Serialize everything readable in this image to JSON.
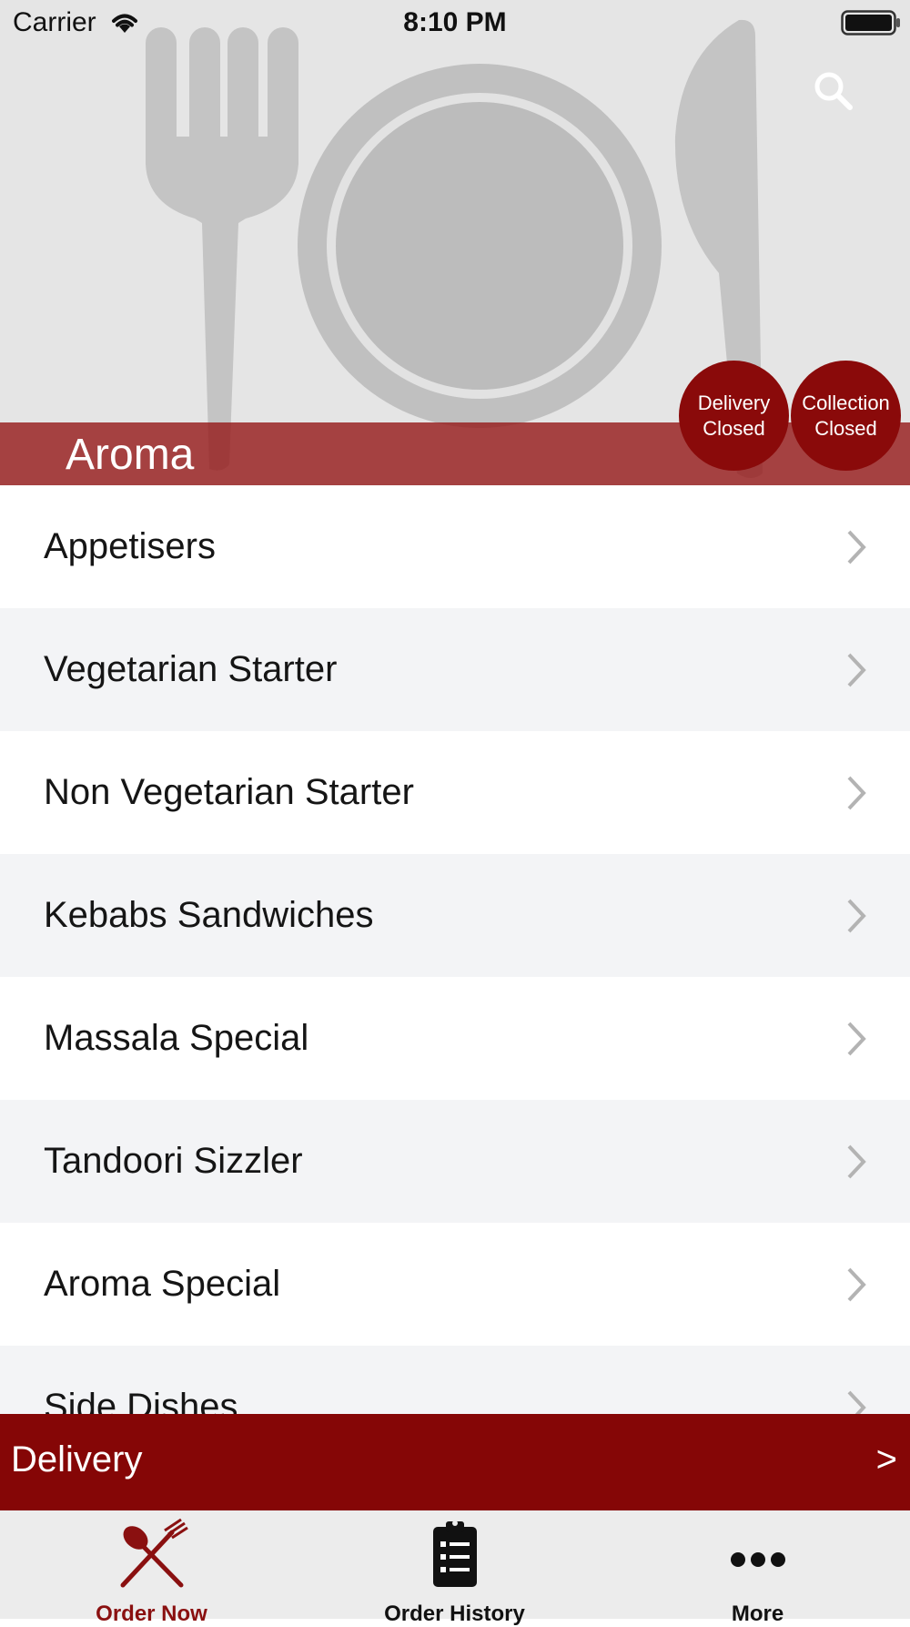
{
  "status_bar": {
    "carrier": "Carrier",
    "time": "8:10 PM"
  },
  "header": {
    "restaurant_name": "Aroma",
    "delivery_status": {
      "line1": "Delivery",
      "line2": "Closed"
    },
    "collection_status": {
      "line1": "Collection",
      "line2": "Closed"
    }
  },
  "menu": {
    "items": [
      {
        "label": "Appetisers"
      },
      {
        "label": "Vegetarian Starter"
      },
      {
        "label": "Non Vegetarian Starter"
      },
      {
        "label": "Kebabs Sandwiches"
      },
      {
        "label": "Massala Special"
      },
      {
        "label": "Tandoori Sizzler"
      },
      {
        "label": "Aroma Special"
      },
      {
        "label": "Side Dishes"
      }
    ]
  },
  "delivery_bar": {
    "label": "Delivery",
    "arrow": ">"
  },
  "tabbar": {
    "tabs": [
      {
        "label": "Order Now",
        "icon": "fork-spoon-icon",
        "active": true
      },
      {
        "label": "Order History",
        "icon": "clipboard-list-icon",
        "active": false
      },
      {
        "label": "More",
        "icon": "more-dots-icon",
        "active": false
      }
    ]
  },
  "colors": {
    "accent": "#850606",
    "title_band": "#9c3535",
    "header_bg": "#e5e5e5",
    "row_alt": "#f3f4f6",
    "tab_active": "#8a1010"
  }
}
